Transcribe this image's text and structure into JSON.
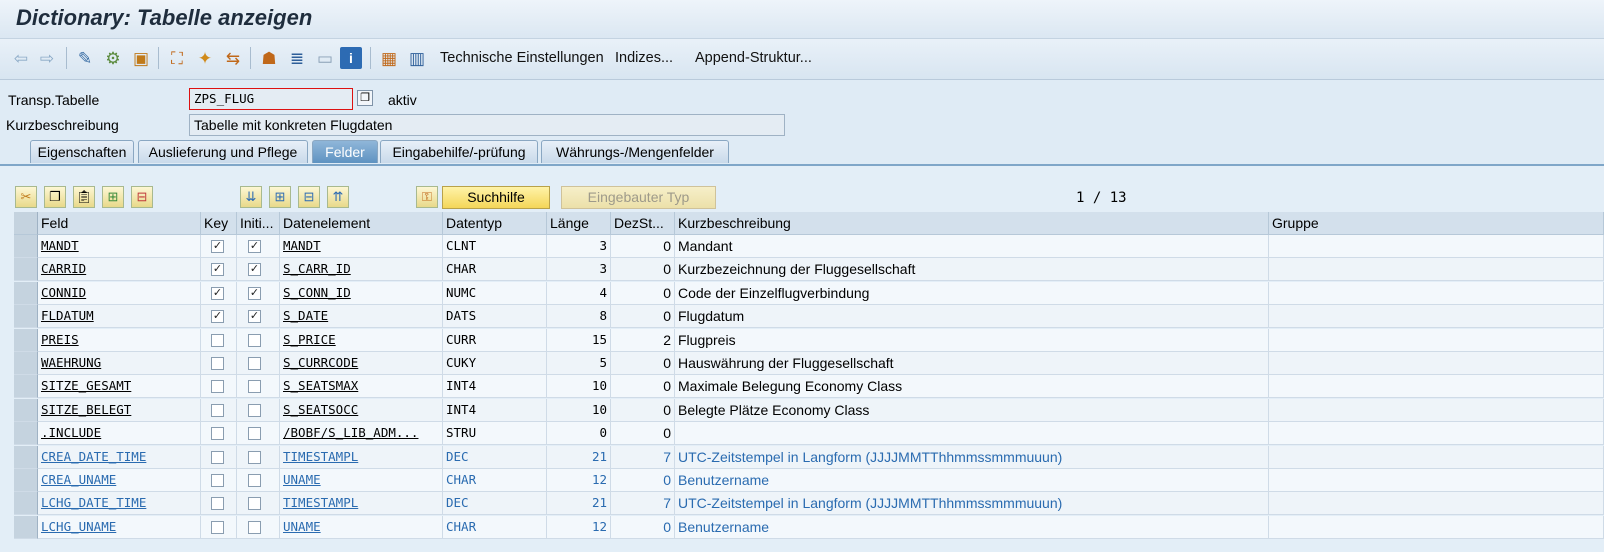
{
  "window": {
    "title": "Dictionary: Tabelle anzeigen"
  },
  "toolbar": {
    "icons": [
      "back-icon",
      "forward-icon",
      "other-object-icon",
      "display-change-icon",
      "activate-icon",
      "where-used-icon",
      "object-list-icon",
      "display-object-list-icon",
      "hierarchy-icon",
      "navigation-icon",
      "layout-icon",
      "info-icon",
      "grid-icon",
      "table-icon"
    ],
    "technische_einstellungen": "Technische Einstellungen",
    "indizes": "Indizes...",
    "append_struktur": "Append-Struktur..."
  },
  "header": {
    "tabelle_label": "Transp.Tabelle",
    "tabelle_value": "ZPS_FLUG",
    "status": "aktiv",
    "kurz_label": "Kurzbeschreibung",
    "kurz_value": "Tabelle mit konkreten Flugdaten"
  },
  "tabs": [
    {
      "label": "Eigenschaften",
      "active": false
    },
    {
      "label": "Auslieferung und Pflege",
      "active": false
    },
    {
      "label": "Felder",
      "active": true
    },
    {
      "label": "Eingabehilfe/-prüfung",
      "active": false
    },
    {
      "label": "Währungs-/Mengenfelder",
      "active": false
    }
  ],
  "panel": {
    "suchhilfe": "Suchhilfe",
    "eingebauter_typ": "Eingebauter Typ",
    "pager": "1 / 13"
  },
  "table": {
    "columns": [
      "Feld",
      "Key",
      "Initi...",
      "Datenelement",
      "Datentyp",
      "Länge",
      "DezSt...",
      "Kurzbeschreibung",
      "Gruppe"
    ],
    "rows": [
      {
        "feld": "MANDT",
        "key": true,
        "init": true,
        "element": "MANDT",
        "typ": "CLNT",
        "laenge": "3",
        "dez": "0",
        "kurz": "Mandant",
        "blue": false
      },
      {
        "feld": "CARRID",
        "key": true,
        "init": true,
        "element": "S_CARR_ID",
        "typ": "CHAR",
        "laenge": "3",
        "dez": "0",
        "kurz": "Kurzbezeichnung der Fluggesellschaft",
        "blue": false
      },
      {
        "feld": "CONNID",
        "key": true,
        "init": true,
        "element": "S_CONN_ID",
        "typ": "NUMC",
        "laenge": "4",
        "dez": "0",
        "kurz": "Code der Einzelflugverbindung",
        "blue": false
      },
      {
        "feld": "FLDATUM",
        "key": true,
        "init": true,
        "element": "S_DATE",
        "typ": "DATS",
        "laenge": "8",
        "dez": "0",
        "kurz": "Flugdatum",
        "blue": false
      },
      {
        "feld": "PREIS",
        "key": false,
        "init": false,
        "element": "S_PRICE",
        "typ": "CURR",
        "laenge": "15",
        "dez": "2",
        "kurz": "Flugpreis",
        "blue": false
      },
      {
        "feld": "WAEHRUNG",
        "key": false,
        "init": false,
        "element": "S_CURRCODE",
        "typ": "CUKY",
        "laenge": "5",
        "dez": "0",
        "kurz": "Hauswährung der Fluggesellschaft",
        "blue": false
      },
      {
        "feld": "SITZE_GESAMT",
        "key": false,
        "init": false,
        "element": "S_SEATSMAX",
        "typ": "INT4",
        "laenge": "10",
        "dez": "0",
        "kurz": "Maximale Belegung Economy Class",
        "blue": false
      },
      {
        "feld": "SITZE_BELEGT",
        "key": false,
        "init": false,
        "element": "S_SEATSOCC",
        "typ": "INT4",
        "laenge": "10",
        "dez": "0",
        "kurz": "Belegte Plätze Economy Class",
        "blue": false
      },
      {
        "feld": ".INCLUDE",
        "key": false,
        "init": false,
        "element": "/BOBF/S_LIB_ADM...",
        "typ": "STRU",
        "laenge": "0",
        "dez": "0",
        "kurz": "",
        "blue": false
      },
      {
        "feld": "CREA_DATE_TIME",
        "key": false,
        "init": false,
        "element": "TIMESTAMPL",
        "typ": "DEC",
        "laenge": "21",
        "dez": "7",
        "kurz": "UTC-Zeitstempel in Langform (JJJJMMTThhmmssmmmuuun)",
        "blue": true
      },
      {
        "feld": "CREA_UNAME",
        "key": false,
        "init": false,
        "element": "UNAME",
        "typ": "CHAR",
        "laenge": "12",
        "dez": "0",
        "kurz": "Benutzername",
        "blue": true
      },
      {
        "feld": "LCHG_DATE_TIME",
        "key": false,
        "init": false,
        "element": "TIMESTAMPL",
        "typ": "DEC",
        "laenge": "21",
        "dez": "7",
        "kurz": "UTC-Zeitstempel in Langform (JJJJMMTThhmmssmmmuuun)",
        "blue": true
      },
      {
        "feld": "LCHG_UNAME",
        "key": false,
        "init": false,
        "element": "UNAME",
        "typ": "CHAR",
        "laenge": "12",
        "dez": "0",
        "kurz": "Benutzername",
        "blue": true
      }
    ]
  }
}
